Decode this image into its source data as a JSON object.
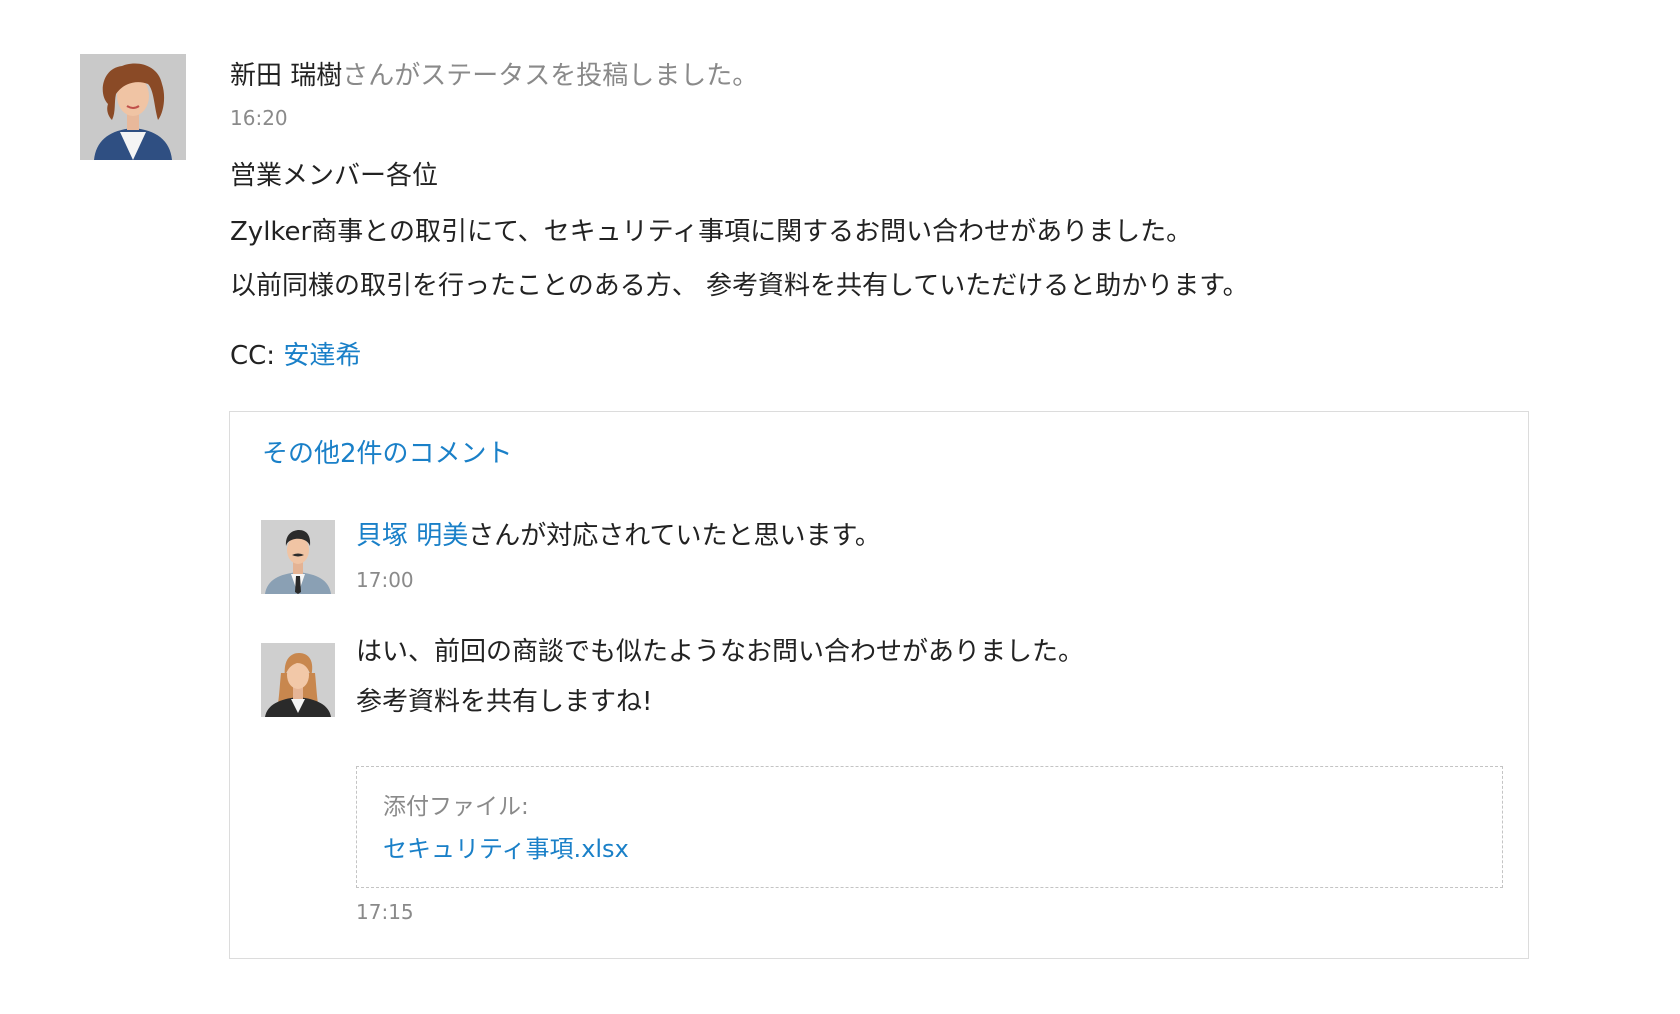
{
  "post": {
    "author_name": "新田 瑞樹",
    "action_text": "さんがステータスを投稿しました。",
    "time": "16:20",
    "body_lines": [
      "営業メンバー各位",
      "Zylker商事との取引にて、セキュリティ事項に関するお問い合わせがありました。",
      "以前同様の取引を行ったことのある方、 参考資料を共有していただけると助かります。"
    ],
    "cc_label": "CC: ",
    "cc_name": "安達希"
  },
  "comments": {
    "more_link": "その他2件のコメント",
    "items": [
      {
        "author_name": "貝塚 明美",
        "text": "さんが対応されていたと思います。",
        "time": "17:00"
      },
      {
        "lines": [
          "はい、前回の商談でも似たようなお問い合わせがありました。",
          "参考資料を共有しますね!"
        ],
        "attachment_label": "添付ファイル:",
        "attachment_file": "セキュリティ事項.xlsx",
        "time": "17:15"
      }
    ]
  },
  "colors": {
    "link": "#1a80c8",
    "muted": "#8a8a8a",
    "text": "#222222",
    "border": "#dcdcdc"
  },
  "icons": {
    "author_avatar": "woman-avatar-icon",
    "comment1_avatar": "man-mustache-avatar-icon",
    "comment2_avatar": "woman-long-hair-avatar-icon"
  }
}
